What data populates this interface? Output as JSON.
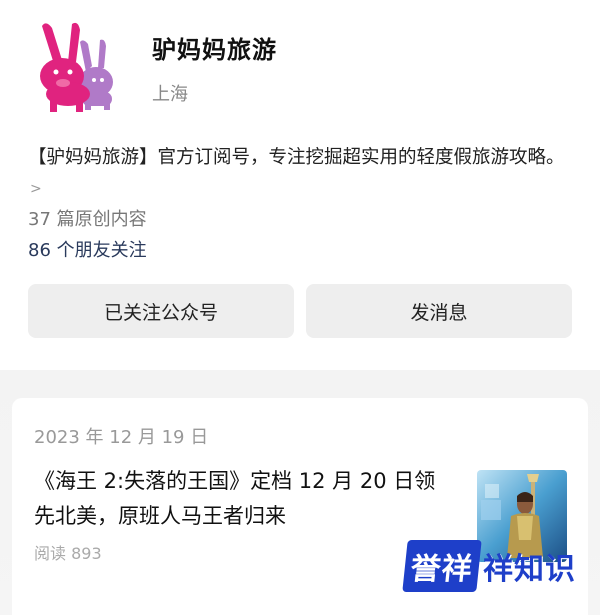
{
  "profile": {
    "name": "驴妈妈旅游",
    "location": "上海",
    "bio": "【驴妈妈旅游】官方订阅号，专注挖掘超实用的轻度假旅游攻略。",
    "bio_chevron": ">",
    "original_count": "37 篇原创内容",
    "followers": "86 个朋友关注",
    "follow_button": "已关注公众号",
    "message_button": "发消息",
    "avatar_icon": "donkey-logo-icon",
    "accent_color": "#e0237f"
  },
  "article": {
    "date": "2023 年 12 月 19 日",
    "title": "《海王 2:失落的王国》定档 12 月 20 日领先北美，原班人马王者归来",
    "reads": "阅读 893",
    "thumbnail": "movie-poster-thumbnail"
  },
  "watermark": {
    "logo_text": "誉祥",
    "text": "祥知识",
    "color": "#1e3fc9"
  }
}
